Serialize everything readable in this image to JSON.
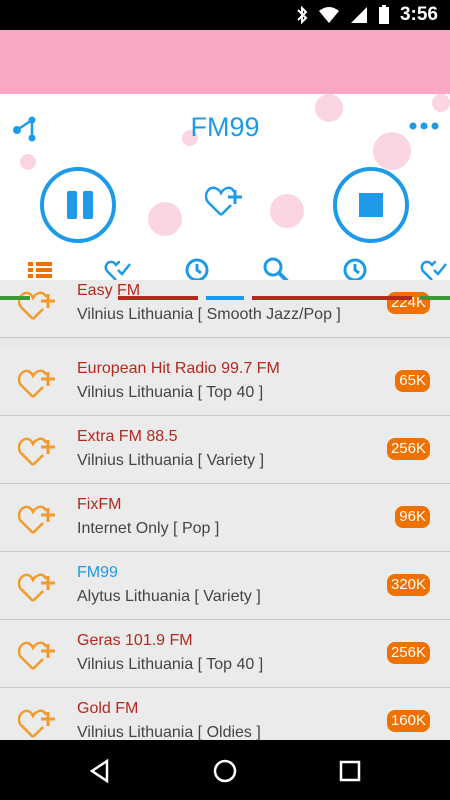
{
  "status": {
    "time": "3:56"
  },
  "player": {
    "station_title": "FM99"
  },
  "stations": [
    {
      "name": "Easy FM",
      "location": "Vilnius Lithuania [ Smooth Jazz/Pop ]",
      "bitrate": "224K",
      "active": false
    },
    {
      "name": "European Hit Radio 99.7 FM",
      "location": "Vilnius Lithuania [ Top 40 ]",
      "bitrate": "65K",
      "active": false
    },
    {
      "name": "Extra FM 88.5",
      "location": "Vilnius Lithuania [ Variety ]",
      "bitrate": "256K",
      "active": false
    },
    {
      "name": "FixFM",
      "location": "Internet Only [ Pop ]",
      "bitrate": "96K",
      "active": false
    },
    {
      "name": "FM99",
      "location": "Alytus Lithuania [ Variety ]",
      "bitrate": "320K",
      "active": true
    },
    {
      "name": "Geras 101.9 FM",
      "location": "Vilnius Lithuania [ Top 40 ]",
      "bitrate": "256K",
      "active": false
    },
    {
      "name": "Gold FM",
      "location": "Vilnius Lithuania [ Oldies ]",
      "bitrate": "160K",
      "active": false
    }
  ],
  "colors": {
    "accent": "#1e9be8",
    "banner": "#f9a7c4",
    "station_name": "#b5281d",
    "bitrate_badge": "#f07000",
    "heart": "#f39a2a"
  },
  "icons": {
    "tabs": [
      "list-icon",
      "favorites-check-icon",
      "history-icon",
      "search-icon",
      "recent-icon",
      "favorites-check-icon"
    ]
  }
}
